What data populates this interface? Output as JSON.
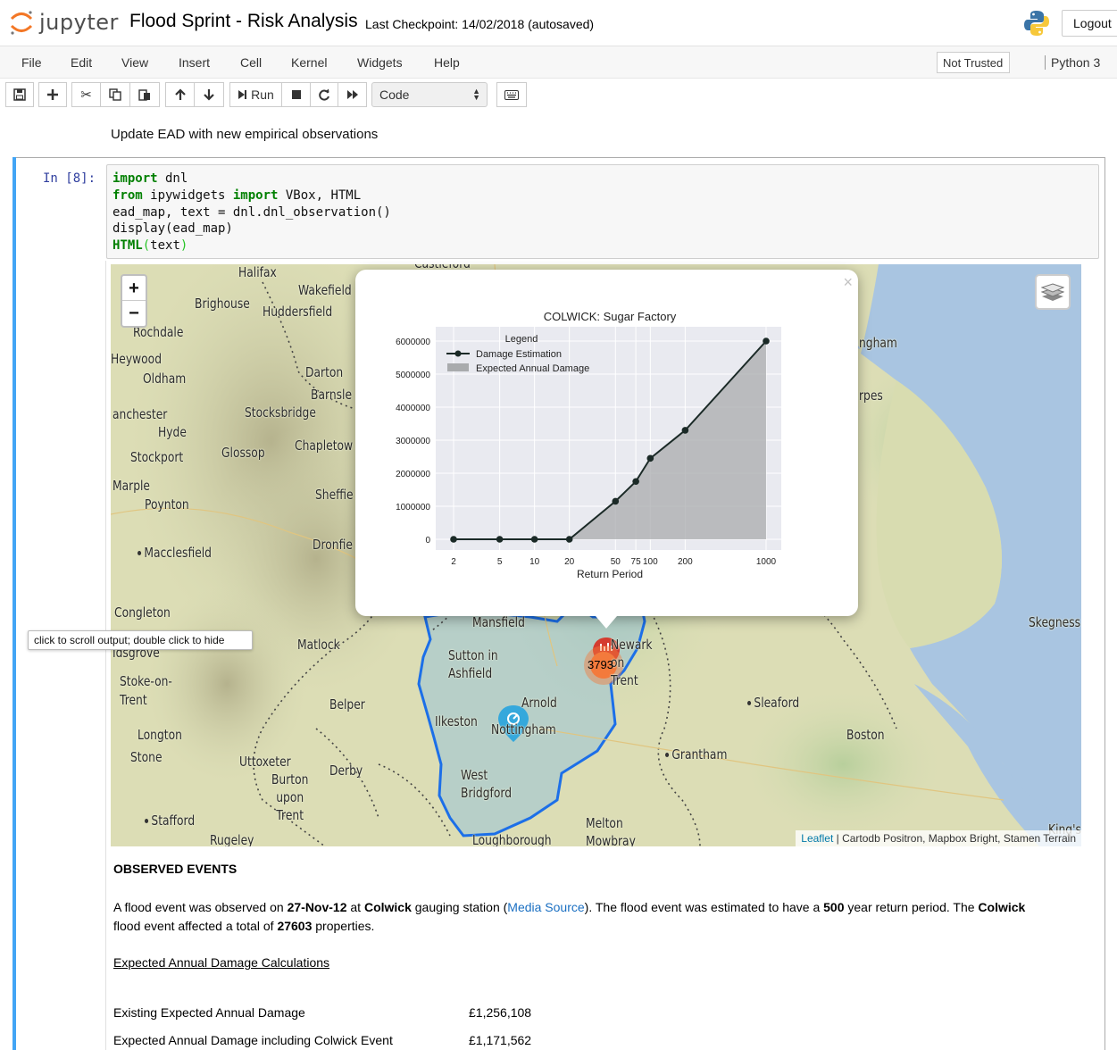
{
  "header": {
    "logo_text": "jupyter",
    "notebook_title": "Flood Sprint - Risk Analysis",
    "checkpoint": "Last Checkpoint: 14/02/2018  (autosaved)",
    "logout_label": "Logout"
  },
  "menu": {
    "items": [
      "File",
      "Edit",
      "View",
      "Insert",
      "Cell",
      "Kernel",
      "Widgets",
      "Help"
    ],
    "trusted_label": "Not Trusted",
    "kernel_label": "Python 3"
  },
  "toolbar": {
    "run_label": "Run",
    "cell_type": "Code"
  },
  "markdown_cell": {
    "text": "Update EAD with new empirical observations"
  },
  "code_cell": {
    "prompt": "In [8]:",
    "lines": [
      {
        "kw": "import",
        "rest": " dnl"
      },
      {
        "kw": "from",
        "rest": " ipywidgets ",
        "kw2": "import",
        "rest2": " VBox, HTML"
      },
      {
        "text": "ead_map, text = dnl.dnl_observation()"
      },
      {
        "text": "display(ead_map)"
      },
      {
        "call": "HTML",
        "arg": "text"
      }
    ]
  },
  "map": {
    "towns": [
      "Halifax",
      "Wakefield",
      "Brighouse",
      "Huddersfield",
      "Rochdale",
      "Heywood",
      "Oldham",
      "Darton",
      "Barnsle",
      "anchester",
      "Stocksbridge",
      "Hyde",
      "Chapletow",
      "Stockport",
      "Glossop",
      "Marple",
      "Poynton",
      "Sheffie",
      "Macclesfield",
      "Dronfie",
      "Congleton",
      "Matlock",
      "Mansfield",
      "Sutton in Ashfield",
      "Newark on Trent",
      "Arnold",
      "Ilkeston",
      "Nottingham",
      "West Bridgford",
      "Idsgrove",
      "Stoke-on-Trent",
      "Longton",
      "Stone",
      "Belper",
      "Uttoxeter",
      "Burton upon Trent",
      "Derby",
      "Stafford",
      "Rugeley",
      "Loughborough",
      "Melton Mowbray",
      "Grantham",
      "Sleaford",
      "Boston",
      "Skegness",
      "ngham",
      "rpes",
      "Castleford",
      "King's"
    ],
    "cluster_count": "3793",
    "attribution_link": "Leaflet",
    "attribution_rest": " | Cartodb Positron, Mapbox Bright, Stamen Terrain",
    "tooltip": "click to scroll output; double click to hide",
    "zoom_in": "+",
    "zoom_out": "−"
  },
  "chart_data": {
    "type": "area",
    "title": "COLWICK: Sugar Factory",
    "xlabel": "Return Period",
    "ylabel": "",
    "x_scale": "log",
    "x": [
      2,
      5,
      10,
      20,
      50,
      75,
      100,
      200,
      1000
    ],
    "x_tick_labels": [
      "2",
      "5",
      "10",
      "20",
      "50",
      "75",
      "100",
      "200",
      "1000"
    ],
    "y_ticks": [
      0,
      1000000,
      2000000,
      3000000,
      4000000,
      5000000,
      6000000
    ],
    "ylim": [
      -250000,
      6250000
    ],
    "series": [
      {
        "name": "Damage Estimation",
        "style": "line-marker",
        "values": [
          0,
          0,
          0,
          0,
          1150000,
          1750000,
          2450000,
          3300000,
          6000000
        ]
      },
      {
        "name": "Expected Annual Damage",
        "style": "area",
        "values": [
          0,
          0,
          0,
          0,
          1150000,
          1750000,
          2450000,
          3300000,
          6000000
        ]
      }
    ],
    "legend_title": "Legend",
    "legend_position": "top-left",
    "grid": true
  },
  "observed": {
    "heading": "OBSERVED EVENTS",
    "p1": "A flood event was observed on ",
    "date": "27-Nov-12",
    "p2": " at ",
    "station": "Colwick",
    "p3": " gauging station (",
    "media_link": "Media Source",
    "p4": "). The flood event was estimated to have a ",
    "return_period": "500",
    "p5": " year return period. The ",
    "station2": "Colwick",
    "p6": "flood event affected a total of ",
    "properties": "27603",
    "p7": " properties.",
    "calc_heading": "Expected Annual Damage Calculations",
    "rows": [
      {
        "label": "Existing Expected Annual Damage",
        "value": "£1,256,108"
      },
      {
        "label": "Expected Annual Damage including Colwick Event",
        "value": "£1,171,562"
      }
    ]
  },
  "colors": {
    "jupyter_orange": "#f37726",
    "cell_selected": "#42a5f5",
    "catchment_line": "#1c6fe8",
    "marker_red": "#d43c2f",
    "cluster_orange": "#f37a3c",
    "marker_blue": "#35a8dc"
  }
}
